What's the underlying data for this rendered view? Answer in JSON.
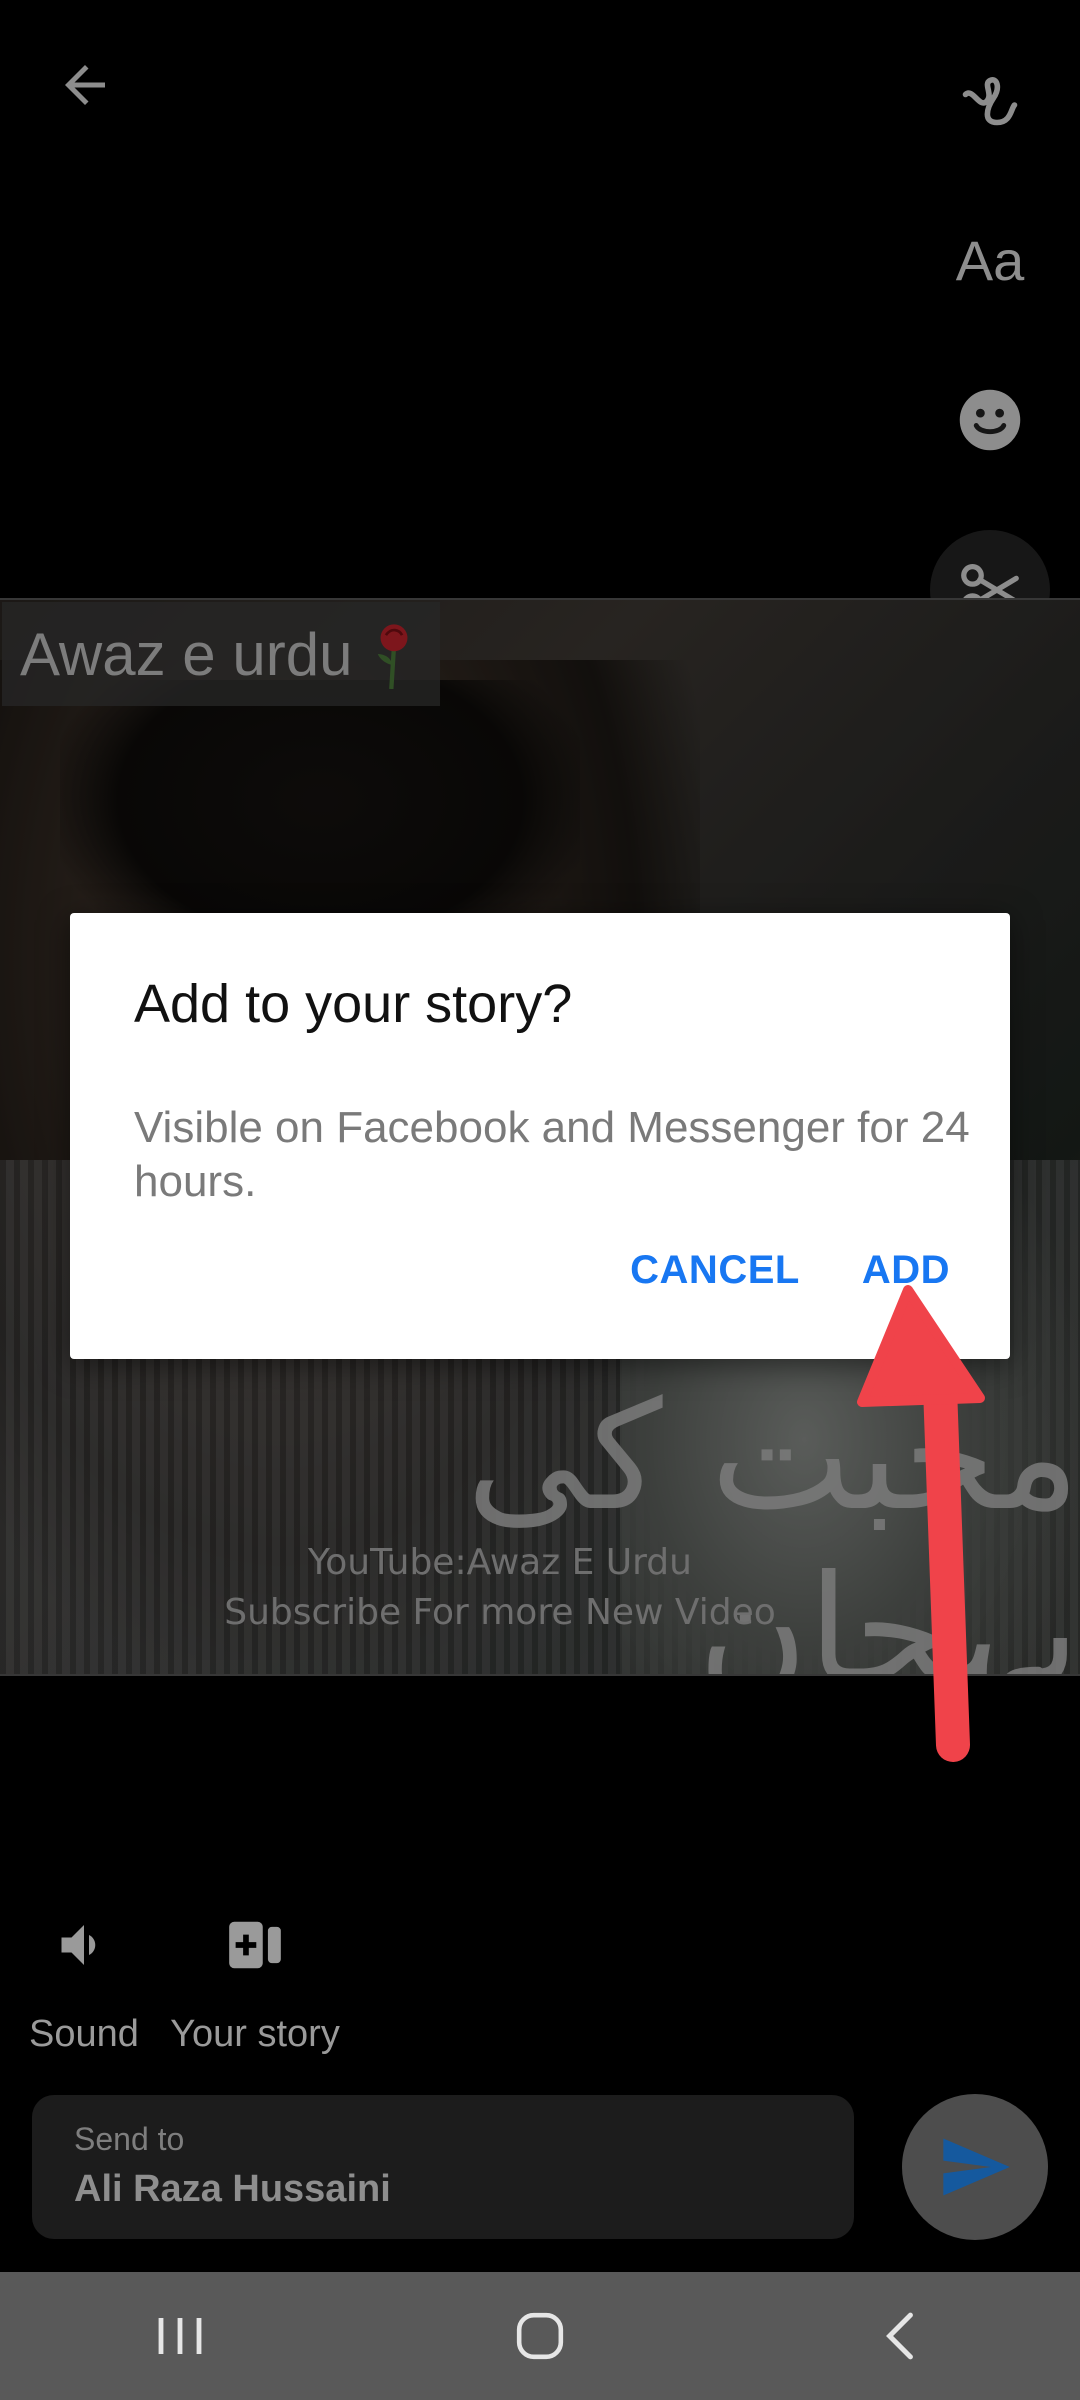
{
  "top_toolbar": {
    "back_icon": "arrow-left-icon",
    "tools": [
      {
        "name": "draw",
        "icon": "squiggle-draw-icon"
      },
      {
        "name": "text",
        "icon": "text-aa-icon",
        "label": "Aa"
      },
      {
        "name": "sticker",
        "icon": "smiley-icon"
      },
      {
        "name": "trim",
        "icon": "scissors-icon"
      }
    ]
  },
  "video": {
    "title": "Awaz e urdu",
    "title_icon": "rose-icon",
    "overlay_urdu": "محبت کی پہچان",
    "watermark_line1": "YouTube:Awaz E Urdu",
    "watermark_line2": "Subscribe For more New Video"
  },
  "dialog": {
    "title": "Add to your story?",
    "body": "Visible on Facebook and Messenger for 24 hours.",
    "cancel_label": "CANCEL",
    "add_label": "ADD"
  },
  "bottom": {
    "sound_label": "Sound",
    "story_label": "Your story",
    "send_to_label": "Send to",
    "recipient": "Ali Raza Hussaini"
  },
  "colors": {
    "accent": "#1877f2",
    "annotation_arrow": "#f0434a",
    "navbar": "#595959"
  }
}
